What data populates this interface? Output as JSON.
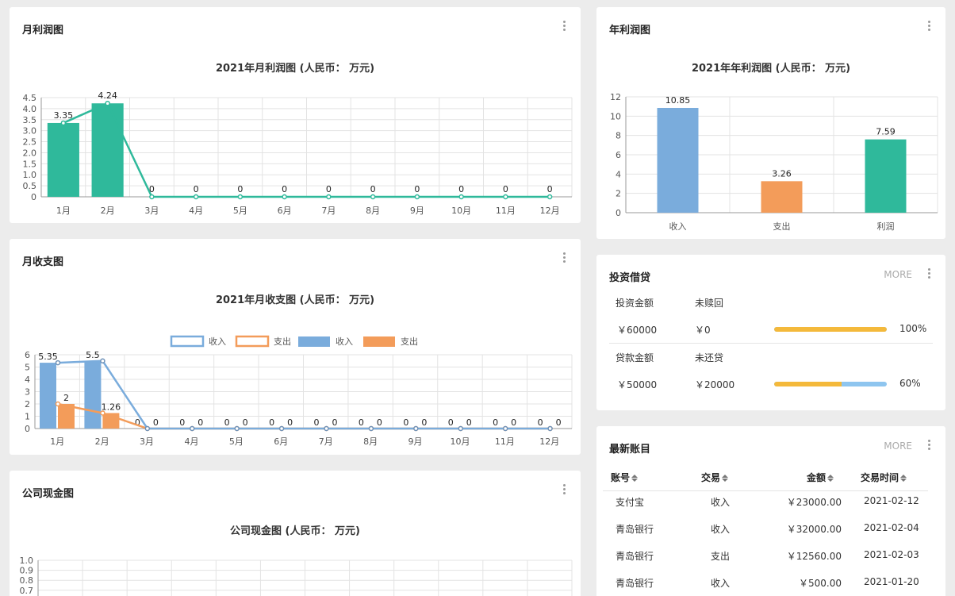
{
  "monthly_profit": {
    "title": "月利润图",
    "chart_title": "2021年月利润图 (人民币： 万元)"
  },
  "monthly_inout": {
    "title": "月收支图",
    "chart_title": "2021年月收支图 (人民币： 万元)"
  },
  "cash": {
    "title": "公司现金图",
    "chart_title": "公司现金图 (人民币： 万元)"
  },
  "annual_profit": {
    "title": "年利润图",
    "chart_title": "2021年年利润图 (人民币： 万元)"
  },
  "investment": {
    "title": "投资借贷",
    "more": "MORE",
    "rows": [
      {
        "label": "投资金额",
        "label2": "未赎回",
        "amount": "￥60000",
        "remain": "￥0",
        "percent_text": "100%",
        "progress": 100
      },
      {
        "label": "贷款金额",
        "label2": "未还贷",
        "amount": "￥50000",
        "remain": "￥20000",
        "percent_text": "60%",
        "progress": 60
      }
    ]
  },
  "ledger": {
    "title": "最新账目",
    "more": "MORE",
    "headers": [
      "账号",
      "交易",
      "金额",
      "交易时间"
    ],
    "rows": [
      {
        "account": "支付宝",
        "type": "收入",
        "amount": "￥23000.00",
        "date": "2021-02-12"
      },
      {
        "account": "青岛银行",
        "type": "收入",
        "amount": "￥32000.00",
        "date": "2021-02-04"
      },
      {
        "account": "青岛银行",
        "type": "支出",
        "amount": "￥12560.00",
        "date": "2021-02-03"
      },
      {
        "account": "青岛银行",
        "type": "收入",
        "amount": "￥500.00",
        "date": "2021-01-20"
      }
    ]
  },
  "colors": {
    "green": "#2fb99b",
    "blue": "#7aacdc",
    "orange": "#f39c5a",
    "gold": "#f4b93b",
    "light_blue": "#8ec5ef"
  },
  "chart_data": [
    {
      "id": "monthly_profit",
      "type": "bar",
      "title": "2021年月利润图 (人民币： 万元)",
      "categories": [
        "1月",
        "2月",
        "3月",
        "4月",
        "5月",
        "6月",
        "7月",
        "8月",
        "9月",
        "10月",
        "11月",
        "12月"
      ],
      "series": [
        {
          "type": "bar",
          "values": [
            3.35,
            4.24,
            0,
            0,
            0,
            0,
            0,
            0,
            0,
            0,
            0,
            0
          ]
        },
        {
          "type": "line",
          "values": [
            3.35,
            4.24,
            0,
            0,
            0,
            0,
            0,
            0,
            0,
            0,
            0,
            0
          ]
        }
      ],
      "yticks": [
        "0",
        "0.5",
        "1.0",
        "1.5",
        "2.0",
        "2.5",
        "3.0",
        "3.5",
        "4.0",
        "4.5"
      ],
      "ylim": [
        0,
        4.5
      ],
      "grid": true
    },
    {
      "id": "monthly_inout",
      "type": "bar",
      "title": "2021年月收支图 (人民币： 万元)",
      "legend": [
        "收入",
        "支出",
        "收入",
        "支出"
      ],
      "categories": [
        "1月",
        "2月",
        "3月",
        "4月",
        "5月",
        "6月",
        "7月",
        "8月",
        "9月",
        "10月",
        "11月",
        "12月"
      ],
      "series": [
        {
          "name": "收入",
          "type": "bar",
          "values": [
            5.35,
            5.5,
            0,
            0,
            0,
            0,
            0,
            0,
            0,
            0,
            0,
            0
          ]
        },
        {
          "name": "支出",
          "type": "bar",
          "values": [
            2,
            1.26,
            0,
            0,
            0,
            0,
            0,
            0,
            0,
            0,
            0,
            0
          ]
        },
        {
          "name": "收入",
          "type": "line",
          "values": [
            5.35,
            5.5,
            0,
            0,
            0,
            0,
            0,
            0,
            0,
            0,
            0,
            0
          ]
        },
        {
          "name": "支出",
          "type": "line",
          "values": [
            2,
            1.26,
            0,
            0,
            0,
            0,
            0,
            0,
            0,
            0,
            0,
            0
          ]
        }
      ],
      "yticks": [
        "0",
        "1",
        "2",
        "3",
        "4",
        "5",
        "6"
      ],
      "ylim": [
        0,
        6
      ],
      "grid": true
    },
    {
      "id": "cash",
      "type": "line",
      "title": "公司现金图 (人民币： 万元)",
      "yticks": [
        "0.7",
        "0.8",
        "0.9",
        "1.0"
      ],
      "ylim": [
        0,
        1.0
      ],
      "grid": true
    },
    {
      "id": "annual_profit",
      "type": "bar",
      "title": "2021年年利润图 (人民币： 万元)",
      "categories": [
        "收入",
        "支出",
        "利润"
      ],
      "values": [
        10.85,
        3.26,
        7.59
      ],
      "yticks": [
        "0",
        "2",
        "4",
        "6",
        "8",
        "10",
        "12"
      ],
      "ylim": [
        0,
        12
      ],
      "grid": true
    }
  ]
}
